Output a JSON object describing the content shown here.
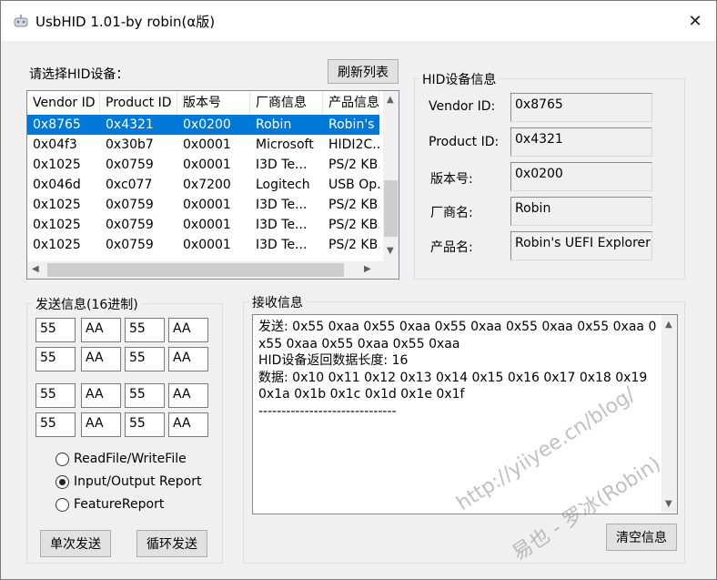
{
  "window": {
    "title": "UsbHID 1.01-by robin(α版)",
    "close_glyph": "✕"
  },
  "device_list": {
    "label": "请选择HID设备：",
    "refresh_button": "刷新列表",
    "columns": [
      "Vendor ID",
      "Product ID",
      "版本号",
      "厂商信息",
      "产品信息"
    ],
    "rows": [
      [
        "0x8765",
        "0x4321",
        "0x0200",
        "Robin",
        "Robin's ..."
      ],
      [
        "0x04f3",
        "0x30b7",
        "0x0001",
        "Microsoft",
        "HIDI2C..."
      ],
      [
        "0x1025",
        "0x0759",
        "0x0001",
        "I3D Te...",
        "PS/2 KB..."
      ],
      [
        "0x046d",
        "0xc077",
        "0x7200",
        "Logitech",
        "USB Op..."
      ],
      [
        "0x1025",
        "0x0759",
        "0x0001",
        "I3D Te...",
        "PS/2 KB..."
      ],
      [
        "0x1025",
        "0x0759",
        "0x0001",
        "I3D Te...",
        "PS/2 KB..."
      ],
      [
        "0x1025",
        "0x0759",
        "0x0001",
        "I3D Te...",
        "PS/2 KB..."
      ]
    ],
    "selected_row": 0
  },
  "device_info": {
    "title": "HID设备信息",
    "vendor_id_label": "Vendor ID:",
    "vendor_id": "0x8765",
    "product_id_label": "Product ID:",
    "product_id": "0x4321",
    "version_label": "版本号:",
    "version": "0x0200",
    "manufacturer_label": "厂商名:",
    "manufacturer": "Robin",
    "product_label": "产品名:",
    "product": "Robin's UEFI Explorer"
  },
  "send": {
    "title": "发送信息(16进制)",
    "bytes": [
      [
        "55",
        "AA",
        "55",
        "AA"
      ],
      [
        "55",
        "AA",
        "55",
        "AA"
      ],
      [
        "55",
        "AA",
        "55",
        "AA"
      ],
      [
        "55",
        "AA",
        "55",
        "AA"
      ]
    ],
    "modes": [
      "ReadFile/WriteFile",
      "Input/Output Report",
      "FeatureReport"
    ],
    "selected_mode": 1,
    "single_send_button": "单次发送",
    "loop_send_button": "循环发送"
  },
  "receive": {
    "title": "接收信息",
    "text": "发送: 0x55 0xaa 0x55 0xaa 0x55 0xaa 0x55 0xaa 0x55 0xaa 0x55 0xaa 0x55 0xaa 0x55 0xaa\nHID设备返回数据长度: 16\n数据: 0x10 0x11 0x12 0x13 0x14 0x15 0x16 0x17 0x18 0x19 0x1a 0x1b 0x1c 0x1d 0x1e 0x1f\n------------------------------",
    "clear_button": "清空信息"
  },
  "watermark": {
    "line1": "http://yiiyee.cn/blog/",
    "line2": "易也 - 罗冰(Robin)"
  }
}
